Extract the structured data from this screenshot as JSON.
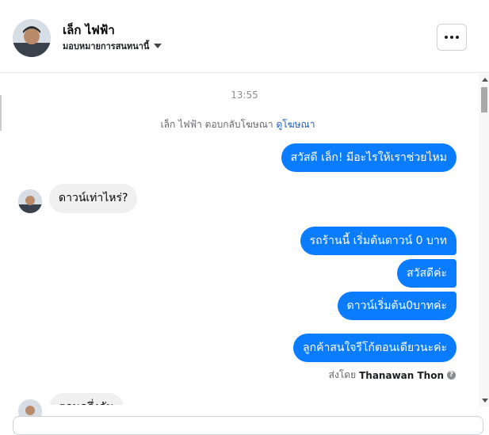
{
  "header": {
    "contact_name": "เล็ก ไฟฟ้า",
    "assign_label": "มอบหมายการสนทนานี้"
  },
  "thread": {
    "timestamp": "13:55",
    "notice_text": "เล็ก ไฟฟ้า ตอบกลับโฆษณา",
    "notice_link": "ดูโฆษณา",
    "messages": [
      {
        "direction": "outgoing",
        "text": "สวัสดี เล็ก! มีอะไรให้เราช่วยไหม"
      },
      {
        "direction": "incoming",
        "text": "ดาวน์เท่าไหร่?"
      },
      {
        "direction": "outgoing",
        "text": "รถร้านนี้ เริ่มต้นดาวน์ 0 บาท"
      },
      {
        "direction": "outgoing",
        "text": "สวัสดีค่ะ"
      },
      {
        "direction": "outgoing",
        "text": "ดาวน์เริ่มต้น0บาทค่ะ"
      },
      {
        "direction": "outgoing",
        "text": "ลูกค้าสนใจรีโก้ตอนเดียวนะค่ะ"
      },
      {
        "direction": "incoming",
        "text": "ตอนครึ่งคัน"
      }
    ],
    "sent_by_prefix": "ส่งโดย",
    "sent_by_name": "Thanawan Thon"
  },
  "colors": {
    "outgoing_bubble": "#0a7cff",
    "incoming_bubble": "#f0f0f0",
    "link": "#1a5bbf"
  }
}
